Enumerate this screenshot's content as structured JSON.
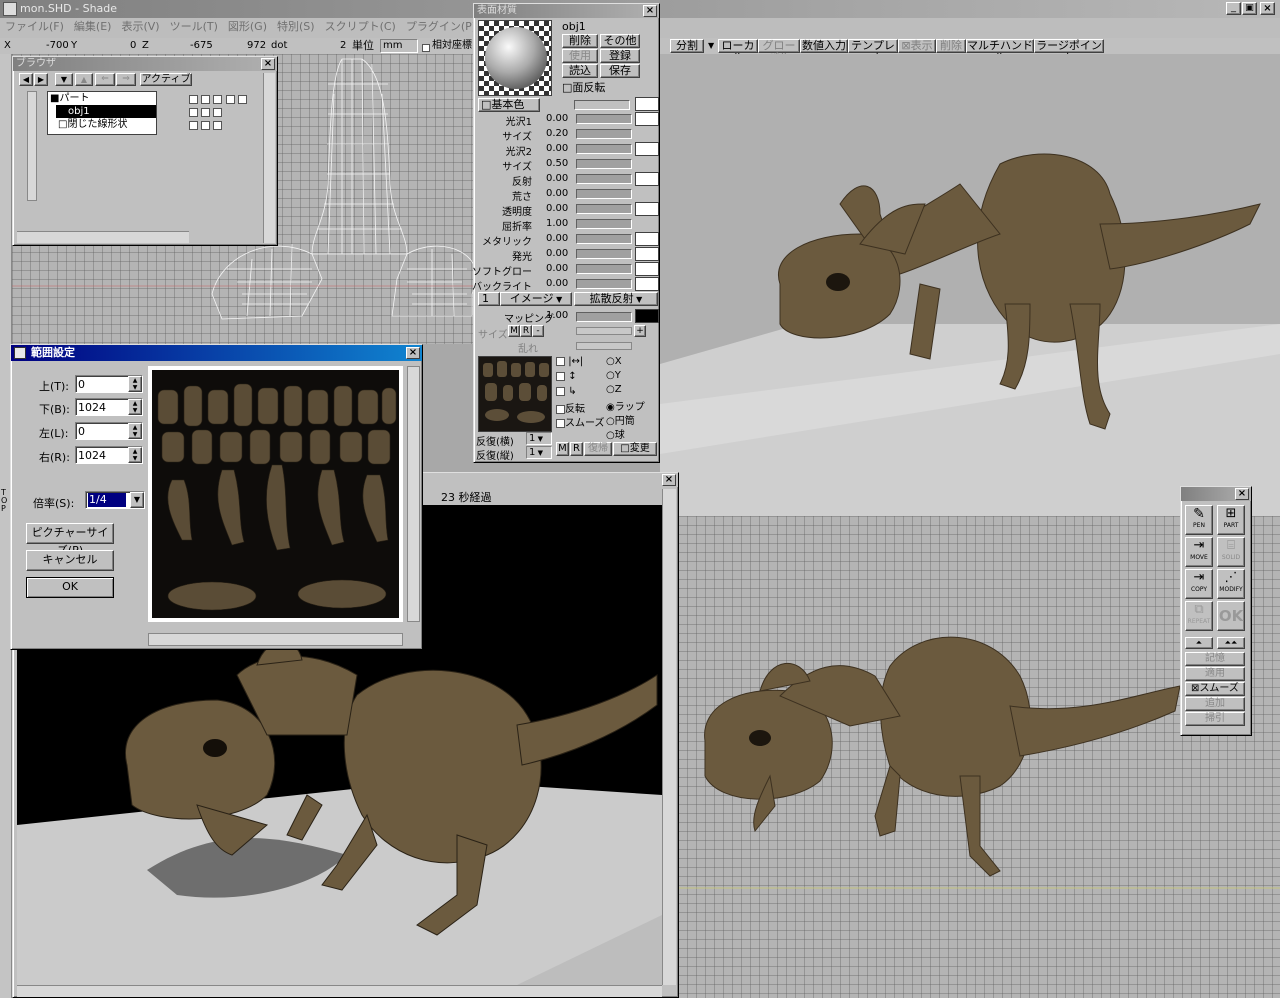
{
  "app": {
    "title": "mon.SHD - Shade",
    "menu": [
      "ファイル(F)",
      "編集(E)",
      "表示(V)",
      "ツール(T)",
      "図形(G)",
      "特別(S)",
      "スクリプト(C)",
      "プラグイン(P)"
    ]
  },
  "coords": {
    "x_label": "X",
    "x_value": "-700",
    "y_label": "Y",
    "y_value": "0",
    "z_label": "Z",
    "z_value": "-675",
    "dot_value": "972",
    "dot_unit": "dot",
    "unit_num": "2",
    "unit_label": "単位",
    "unit_value": "mm",
    "relative_label": "相対座標"
  },
  "toolbar_right": [
    "分割",
    "ローカル",
    "グローバル",
    "数値入力",
    "テンプレート",
    "表示",
    "削除",
    "マルチハンドル",
    "ラージポイント"
  ],
  "browser": {
    "title": "ブラウザ",
    "active_label": "アクティブ",
    "items": [
      "パート",
      "obj1",
      "閉じた線形状"
    ]
  },
  "material": {
    "title": "表面材質",
    "name": "obj1",
    "buttons": {
      "delete": "削除",
      "other": "その他",
      "use": "使用",
      "register": "登録",
      "load": "読込",
      "save": "保存"
    },
    "face_flip": "面反転",
    "basic_color": "基本色",
    "rows": [
      {
        "label": "光沢1",
        "value": "0.00"
      },
      {
        "label": "サイズ",
        "value": "0.20"
      },
      {
        "label": "光沢2",
        "value": "0.00"
      },
      {
        "label": "サイズ",
        "value": "0.50"
      },
      {
        "label": "反射",
        "value": "0.00"
      },
      {
        "label": "荒さ",
        "value": "0.00"
      },
      {
        "label": "透明度",
        "value": "0.00"
      },
      {
        "label": "屈折率",
        "value": "1.00"
      },
      {
        "label": "メタリック",
        "value": "0.00"
      },
      {
        "label": "発光",
        "value": "0.00"
      },
      {
        "label": "ソフトグロー",
        "value": "0.00"
      },
      {
        "label": "バックライト",
        "value": "0.00"
      }
    ],
    "layer_num": "1",
    "layer_type": "イメージ",
    "mapping_type": "拡散反射",
    "mapping_label": "マッピング",
    "mapping_value": "1.00",
    "size_label": "サイズ",
    "size_m": "M",
    "size_r": "R",
    "size_minus": "-",
    "size_plus": "+",
    "chaos_label": "乱れ",
    "invert": "反転",
    "smooth": "スムーズ",
    "axes": [
      "X",
      "Y",
      "Z"
    ],
    "wrap": [
      "ラップ",
      "円筒",
      "球"
    ],
    "repeat_h_label": "反復(横)",
    "repeat_h": "1",
    "repeat_v_label": "反復(縦)",
    "repeat_v": "1",
    "btn_m": "M",
    "btn_r": "R",
    "restore": "復帰",
    "change": "変更"
  },
  "range_dialog": {
    "title": "範囲設定",
    "fields": [
      {
        "label": "上(T):",
        "value": "0"
      },
      {
        "label": "下(B):",
        "value": "1024"
      },
      {
        "label": "左(L):",
        "value": "0"
      },
      {
        "label": "右(R):",
        "value": "1024"
      }
    ],
    "ratio_label": "倍率(S):",
    "ratio_value": "1/4",
    "picture_size_button": "ピクチャーサイズ(P)",
    "cancel_button": "キャンセル",
    "ok_button": "OK"
  },
  "render_window": {
    "status": "23 秒経過"
  },
  "tool_palette": {
    "tools": [
      "PEN",
      "PART",
      "MOVE",
      "SOLID",
      "COPY",
      "MODIFY",
      "REPEAT",
      "OK"
    ],
    "actions": [
      "記憶",
      "適用",
      "スムーズ",
      "追加",
      "掃引"
    ]
  },
  "side_label": "TOP",
  "colors": {
    "model_brown": "#6b5a3e",
    "floor": "#c4c4c4",
    "active_title": "#000080",
    "highlight": "#000080"
  }
}
